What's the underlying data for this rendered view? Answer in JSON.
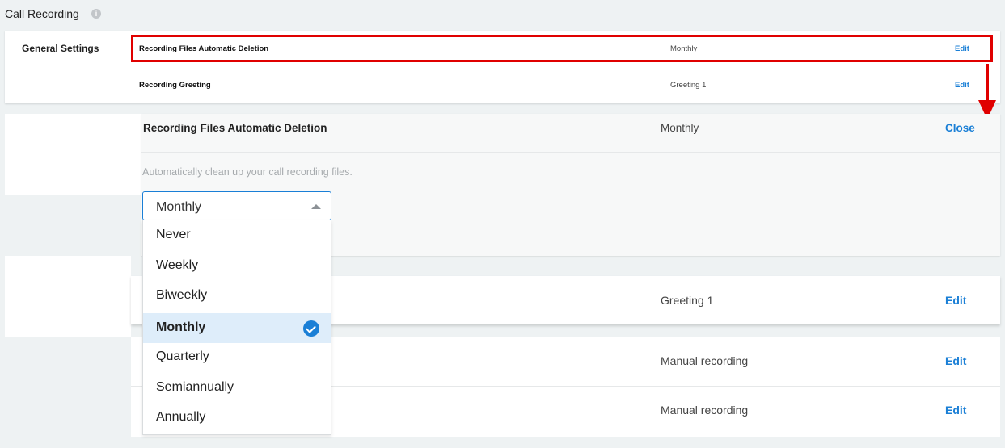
{
  "header": {
    "title": "Call Recording",
    "info_icon": "i"
  },
  "general_settings": {
    "label": "General Settings",
    "rows": [
      {
        "label": "Recording Files Automatic Deletion",
        "value": "Monthly",
        "action": "Edit"
      },
      {
        "label": "Recording Greeting",
        "value": "Greeting 1",
        "action": "Edit"
      }
    ]
  },
  "expanded": {
    "title": "Recording Files Automatic Deletion",
    "value": "Monthly",
    "close_label": "Close",
    "description": "Automatically clean up your call recording files.",
    "select": {
      "current": "Monthly",
      "options": [
        "Never",
        "Weekly",
        "Biweekly",
        "Monthly",
        "Quarterly",
        "Semiannually",
        "Annually"
      ],
      "selected_index": 3
    }
  },
  "lower_rows": [
    {
      "value": "Greeting 1",
      "action": "Edit"
    },
    {
      "value": "Manual recording",
      "action": "Edit"
    },
    {
      "value": "Manual recording",
      "action": "Edit"
    }
  ],
  "colors": {
    "accent": "#1a7fd6",
    "annotation": "#e00000",
    "selected_bg": "#deedfa"
  },
  "icons": {
    "info": "info-icon",
    "caret": "caret-up-icon",
    "check": "check-circle-icon",
    "arrow": "arrow-down-icon"
  }
}
